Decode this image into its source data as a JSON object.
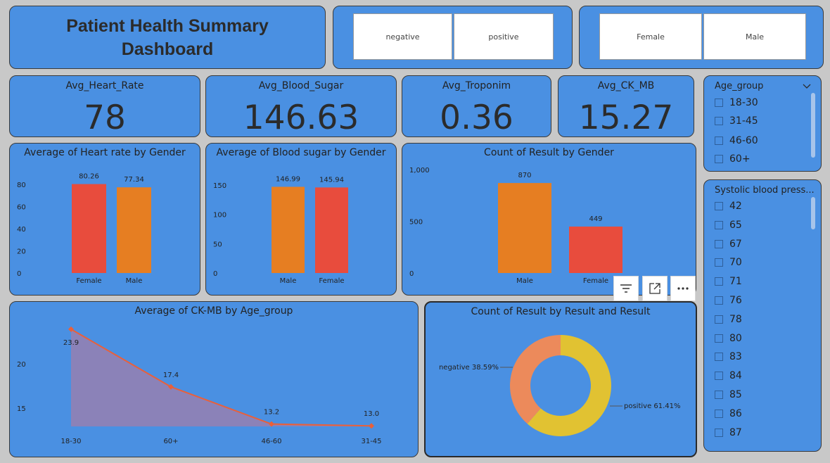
{
  "header": {
    "title_line1": "Patient Health Summary",
    "title_line2": "Dashboard"
  },
  "result_slicer": {
    "options": [
      "negative",
      "positive"
    ]
  },
  "gender_slicer": {
    "options": [
      "Female",
      "Male"
    ]
  },
  "kpis": [
    {
      "label": "Avg_Heart_Rate",
      "value": "78"
    },
    {
      "label": "Avg_Blood_Sugar",
      "value": "146.63"
    },
    {
      "label": "Avg_Troponim",
      "value": "0.36"
    },
    {
      "label": "Avg_CK_MB",
      "value": "15.27"
    }
  ],
  "age_group_slicer": {
    "title": "Age_group",
    "items": [
      "18-30",
      "31-45",
      "46-60",
      "60+"
    ]
  },
  "systolic_slicer": {
    "title": "Systolic blood press...",
    "items": [
      "42",
      "65",
      "67",
      "70",
      "71",
      "76",
      "78",
      "80",
      "83",
      "84",
      "85",
      "86",
      "87"
    ]
  },
  "colors": {
    "bg": "#4a90e2",
    "red": "#e84c3d",
    "orange": "#e67e22",
    "line": "#e9603a",
    "area": "#8b82b8",
    "donut_neg": "#ec8a5b",
    "donut_pos": "#e1c232"
  },
  "visual_toolbar": {
    "icons": [
      "filter-icon",
      "focus-mode-icon",
      "more-options-icon"
    ]
  },
  "chart_data": [
    {
      "type": "bar",
      "title": "Average of Heart rate by Gender",
      "categories": [
        "Female",
        "Male"
      ],
      "values": [
        80.26,
        77.34
      ],
      "data_labels": [
        "80.26",
        "77.34"
      ],
      "bar_colors": [
        "#e84c3d",
        "#e67e22"
      ],
      "ylim": [
        0,
        80
      ],
      "yticks": [
        "0",
        "20",
        "40",
        "60",
        "80"
      ],
      "ytick_values": [
        0,
        20,
        40,
        60,
        80
      ]
    },
    {
      "type": "bar",
      "title": "Average of Blood sugar by Gender",
      "categories": [
        "Male",
        "Female"
      ],
      "values": [
        146.99,
        145.94
      ],
      "data_labels": [
        "146.99",
        "145.94"
      ],
      "bar_colors": [
        "#e67e22",
        "#e84c3d"
      ],
      "ylim": [
        0,
        150
      ],
      "yticks": [
        "0",
        "50",
        "100",
        "150"
      ],
      "ytick_values": [
        0,
        50,
        100,
        150
      ]
    },
    {
      "type": "bar",
      "title": "Count of Result by Gender",
      "categories": [
        "Male",
        "Female"
      ],
      "values": [
        870,
        449
      ],
      "data_labels": [
        "870",
        "449"
      ],
      "bar_colors": [
        "#e67e22",
        "#e84c3d"
      ],
      "ylim": [
        0,
        1000
      ],
      "yticks": [
        "0",
        "500",
        "1,000"
      ],
      "ytick_values": [
        0,
        500,
        1000
      ]
    },
    {
      "type": "area",
      "title": "Average of CK-MB by Age_group",
      "categories": [
        "18-30",
        "60+",
        "46-60",
        "31-45"
      ],
      "values": [
        23.9,
        17.4,
        13.2,
        13.0
      ],
      "data_labels": [
        "23.9",
        "17.4",
        "13.2",
        "13.0"
      ],
      "yticks": [
        "15",
        "20"
      ],
      "ytick_values": [
        15,
        20
      ]
    },
    {
      "type": "pie",
      "title": "Count of Result by Result and Result",
      "categories": [
        "negative",
        "positive"
      ],
      "values": [
        38.59,
        61.41
      ],
      "data_labels": [
        "negative 38.59%",
        "positive 61.41%"
      ]
    }
  ]
}
